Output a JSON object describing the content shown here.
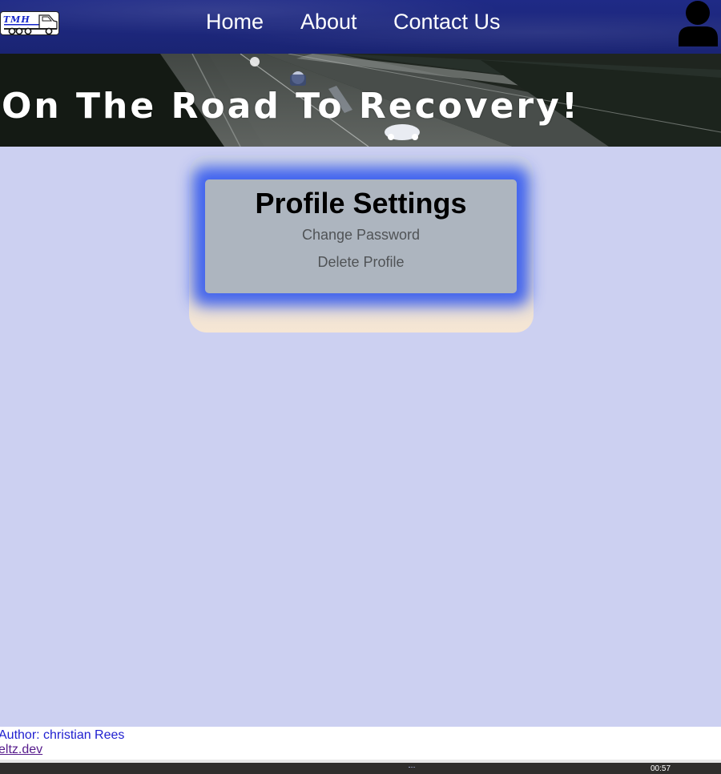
{
  "brand": {
    "logo_text": "TMH",
    "logo_icon": "truck-icon"
  },
  "nav": {
    "items": [
      {
        "label": "Home"
      },
      {
        "label": "About"
      },
      {
        "label": "Contact Us"
      }
    ],
    "user_icon": "user-icon"
  },
  "hero": {
    "title": "On The Road To Recovery!"
  },
  "profile_settings": {
    "title": "Profile Settings",
    "links": [
      {
        "label": "Change Password"
      },
      {
        "label": "Delete Profile"
      }
    ]
  },
  "footer": {
    "author": "Author: christian Rees",
    "link": "eltz.dev"
  },
  "taskbar": {
    "clock": "00:57"
  },
  "colors": {
    "nav_background": "#1f2a86",
    "page_background": "#ccd0f1",
    "card_glow": "#2850f0",
    "card_inner": "#adb5bf"
  }
}
